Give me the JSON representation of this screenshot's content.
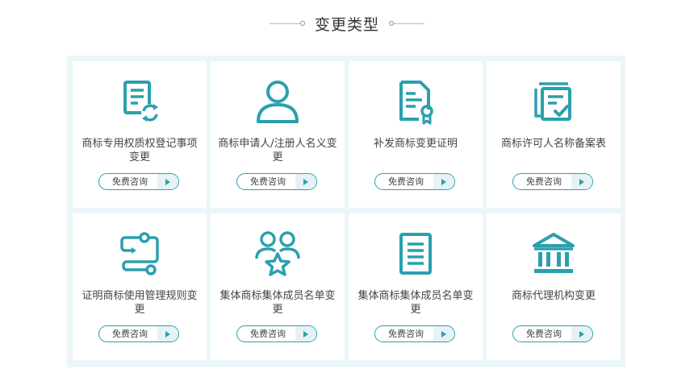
{
  "header": {
    "title": "变更类型"
  },
  "theme": {
    "accent": "#2aa0ad",
    "panel_bg": "#eaf6f8"
  },
  "cards": [
    {
      "icon": "document-refresh-icon",
      "label": "商标专用权质权登记事项变更",
      "button": "免费咨询"
    },
    {
      "icon": "person-icon",
      "label": "商标申请人/注册人名义变更",
      "button": "免费咨询"
    },
    {
      "icon": "certificate-icon",
      "label": "补发商标变更证明",
      "button": "免费咨询"
    },
    {
      "icon": "document-check-icon",
      "label": "商标许可人名称备案表",
      "button": "免费咨询"
    },
    {
      "icon": "workflow-icon",
      "label": "证明商标使用管理规则变更",
      "button": "免费咨询"
    },
    {
      "icon": "group-star-icon",
      "label": "集体商标集体成员名单变更",
      "button": "免费咨询"
    },
    {
      "icon": "list-document-icon",
      "label": "集体商标集体成员名单变更",
      "button": "免费咨询"
    },
    {
      "icon": "bank-building-icon",
      "label": "商标代理机构变更",
      "button": "免费咨询"
    }
  ]
}
